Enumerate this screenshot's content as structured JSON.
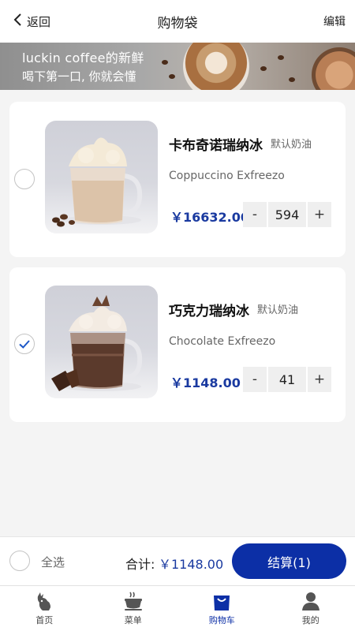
{
  "header": {
    "back_label": "返回",
    "title": "购物袋",
    "edit_label": "编辑"
  },
  "banner": {
    "line1": "luckin coffee的新鲜",
    "line2": "喝下第一口, 你就会懂"
  },
  "cart": {
    "items": [
      {
        "name": "卡布奇诺瑞纳冰",
        "tag": "默认奶油",
        "english": "Coppuccino Exfreezo",
        "price": "￥16632.00",
        "quantity": "594",
        "selected": false
      },
      {
        "name": "巧克力瑞纳冰",
        "tag": "默认奶油",
        "english": "Chocolate Exfreezo",
        "price": "￥1148.00",
        "quantity": "41",
        "selected": true
      }
    ],
    "stepper": {
      "minus": "-",
      "plus": "+"
    }
  },
  "checkout": {
    "select_all": "全选",
    "total_label": "合计:",
    "total_amount": "￥1148.00",
    "pay_button": "结算(1)"
  },
  "tabbar": {
    "tabs": [
      {
        "label": "首页",
        "icon": "deer-logo-icon",
        "active": false
      },
      {
        "label": "菜单",
        "icon": "coffee-cup-icon",
        "active": false
      },
      {
        "label": "购物车",
        "icon": "shopping-bag-icon",
        "active": true
      },
      {
        "label": "我的",
        "icon": "user-icon",
        "active": false
      }
    ]
  },
  "colors": {
    "accent": "#0c2fa6",
    "price": "#1a3aa0",
    "background": "#f4f4f4"
  }
}
